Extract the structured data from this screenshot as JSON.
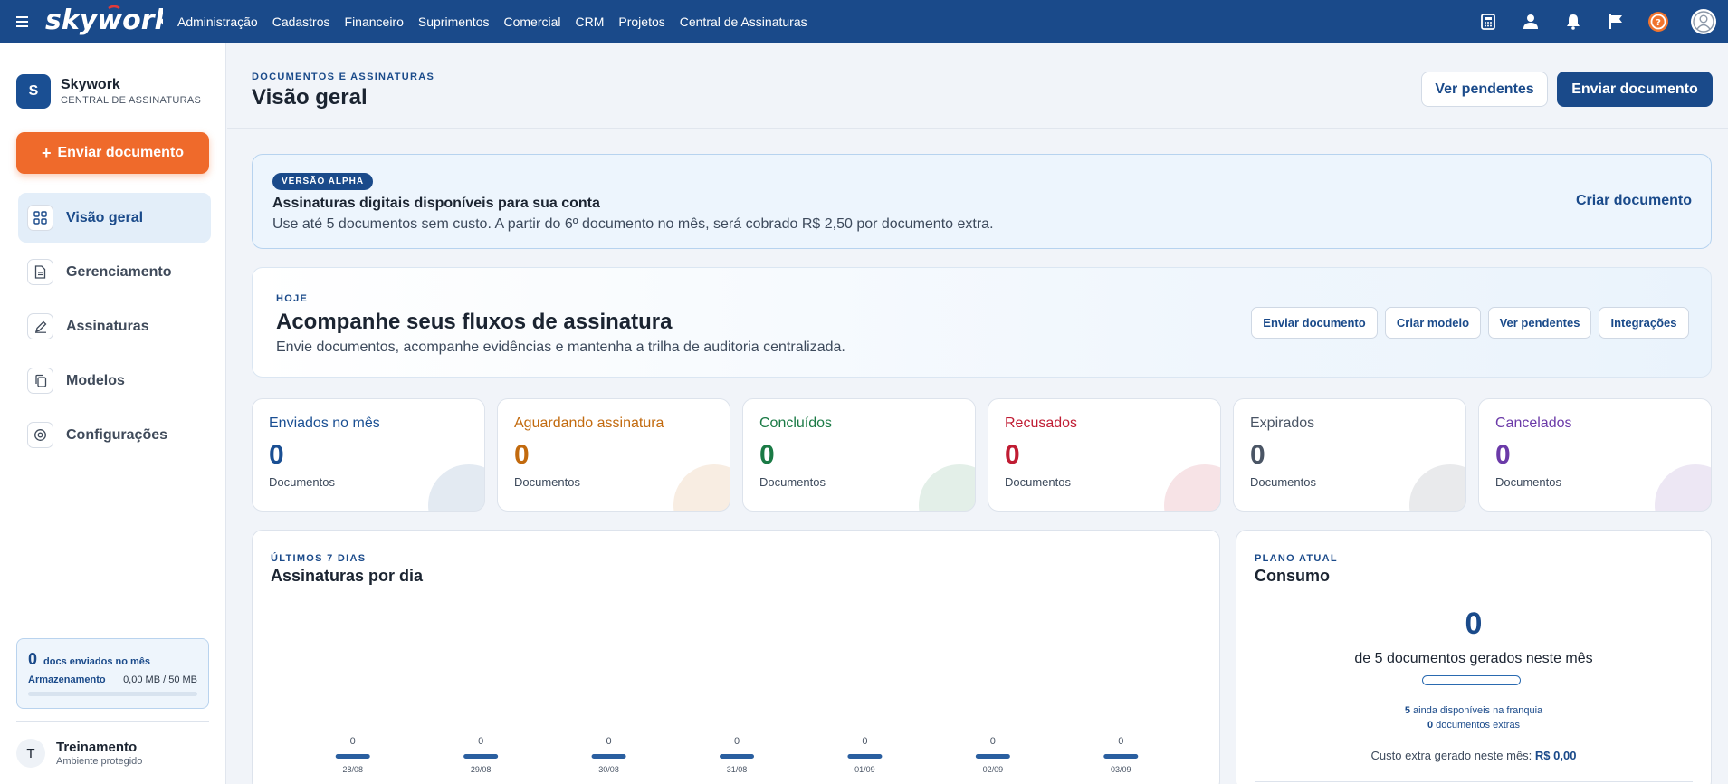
{
  "topnav": {
    "brand": "skywork",
    "items": [
      "Administração",
      "Cadastros",
      "Financeiro",
      "Suprimentos",
      "Comercial",
      "CRM",
      "Projetos",
      "Central de Assinaturas"
    ],
    "icons": [
      "calculator-icon",
      "user-icon",
      "bell-icon",
      "flag-icon",
      "help-icon",
      "profile-avatar-icon"
    ]
  },
  "sidebar": {
    "badge": "S",
    "company": "Skywork",
    "company_sub": "CENTRAL DE ASSINATURAS",
    "cta_plus": "+",
    "cta": "Enviar documento",
    "items": [
      {
        "label": "Visão geral",
        "icon": "grid-icon",
        "active": true
      },
      {
        "label": "Gerenciamento",
        "icon": "document-icon",
        "active": false
      },
      {
        "label": "Assinaturas",
        "icon": "pen-icon",
        "active": false
      },
      {
        "label": "Modelos",
        "icon": "copy-icon",
        "active": false
      },
      {
        "label": "Configurações",
        "icon": "settings-icon",
        "active": false
      }
    ],
    "usage": {
      "count": "0",
      "count_label": "docs enviados no mês",
      "storage_label": "Armazenamento",
      "storage_value": "0,00 MB / 50 MB",
      "storage_fraction": 0
    },
    "user": {
      "initial": "T",
      "name": "Treinamento",
      "sub": "Ambiente protegido"
    }
  },
  "header": {
    "eyebrow": "DOCUMENTOS E ASSINATURAS",
    "title": "Visão geral",
    "pending_button": "Ver pendentes",
    "send_button": "Enviar documento"
  },
  "alpha": {
    "badge": "VERSÃO ALPHA",
    "title": "Assinaturas digitais disponíveis para sua conta",
    "text": "Use até 5 documentos sem custo. A partir do 6º documento no mês, será cobrado R$ 2,50 por documento extra.",
    "link": "Criar documento"
  },
  "today": {
    "eyebrow": "HOJE",
    "title": "Acompanhe seus fluxos de assinatura",
    "text": "Envie documentos, acompanhe evidências e mantenha a trilha de auditoria centralizada.",
    "actions": [
      "Enviar documento",
      "Criar modelo",
      "Ver pendentes",
      "Integrações"
    ]
  },
  "stats": [
    {
      "label": "Enviados no mês",
      "value": "0",
      "sub": "Documentos",
      "color": "#1a4f93"
    },
    {
      "label": "Aguardando assinatura",
      "value": "0",
      "sub": "Documentos",
      "color": "#c26a0e"
    },
    {
      "label": "Concluídos",
      "value": "0",
      "sub": "Documentos",
      "color": "#1a7a45"
    },
    {
      "label": "Recusados",
      "value": "0",
      "sub": "Documentos",
      "color": "#c01c33"
    },
    {
      "label": "Expirados",
      "value": "0",
      "sub": "Documentos",
      "color": "#4a5565"
    },
    {
      "label": "Cancelados",
      "value": "0",
      "sub": "Documentos",
      "color": "#6b3aa8"
    }
  ],
  "chart_panel": {
    "eyebrow": "ÚLTIMOS 7 DIAS",
    "title": "Assinaturas por dia"
  },
  "chart_data": {
    "type": "bar",
    "title": "Assinaturas por dia",
    "categories": [
      "28/08",
      "29/08",
      "30/08",
      "31/08",
      "01/09",
      "02/09",
      "03/09"
    ],
    "values": [
      0,
      0,
      0,
      0,
      0,
      0,
      0
    ],
    "bar_color": "#2a5fa0",
    "grid": false,
    "data_labels": true
  },
  "consumo": {
    "eyebrow": "PLANO ATUAL",
    "title": "Consumo",
    "value": "0",
    "sub": "de 5 documentos gerados neste mês",
    "used_fraction": 0,
    "line1_num": "5",
    "line1_text": "ainda disponíveis na franquia",
    "line2_num": "0",
    "line2_text": "documentos extras",
    "cost_label": "Custo extra gerado neste mês:",
    "cost_value": "R$ 0,00"
  }
}
